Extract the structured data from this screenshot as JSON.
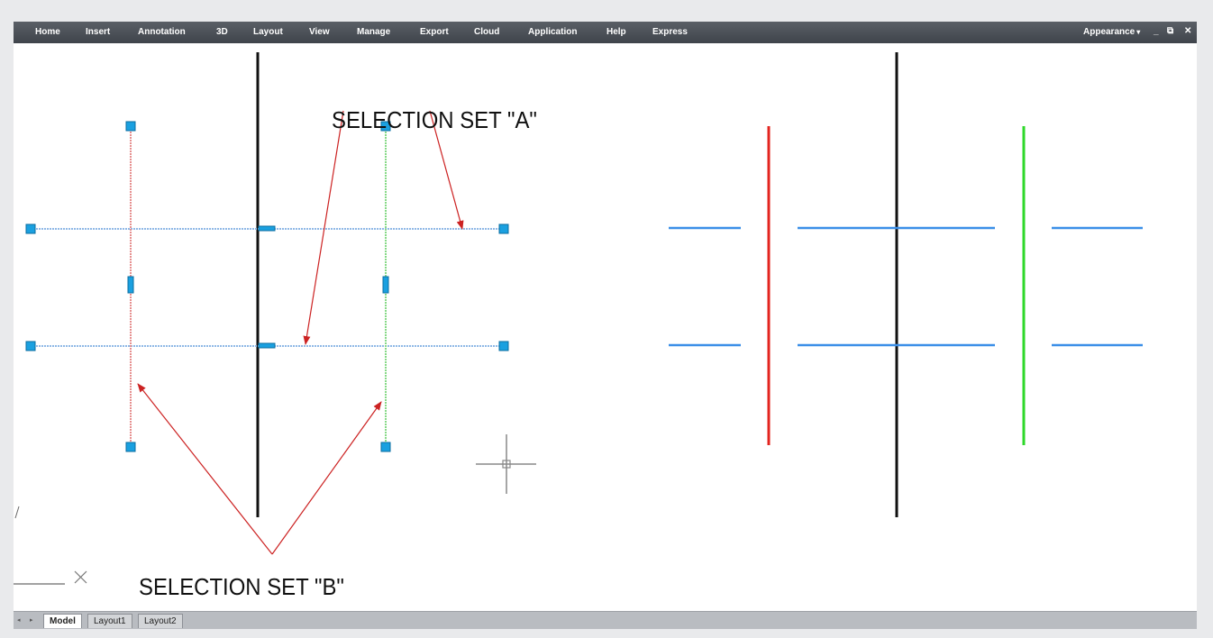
{
  "menubar": {
    "items": [
      "Home",
      "Insert",
      "Annotation",
      "3D",
      "Layout",
      "View",
      "Manage",
      "Export",
      "Cloud",
      "Application",
      "Help",
      "Express"
    ],
    "appearance": "Appearance",
    "window_controls": [
      "_",
      "⧉",
      "✕"
    ]
  },
  "annotations": {
    "set_a": "SELECTION SET \"A\"",
    "set_b": "SELECTION SET \"B\""
  },
  "tabs": {
    "model": "Model",
    "layout1": "Layout1",
    "layout2": "Layout2"
  },
  "icons": {
    "crosshair": "crosshair-cursor-icon",
    "ucs": "ucs-axis-icon",
    "tab_nav_prev": "tab-nav-prev-icon",
    "tab_nav_next": "tab-nav-next-icon"
  },
  "colors": {
    "menubar": "#474c53",
    "selected_line": "#8fb8e6",
    "blue_line": "#3b8fe8",
    "red_line": "#e3241f",
    "green_line": "#2ed82a",
    "grip": "#1aa0e0",
    "arrow": "#cc2222"
  }
}
